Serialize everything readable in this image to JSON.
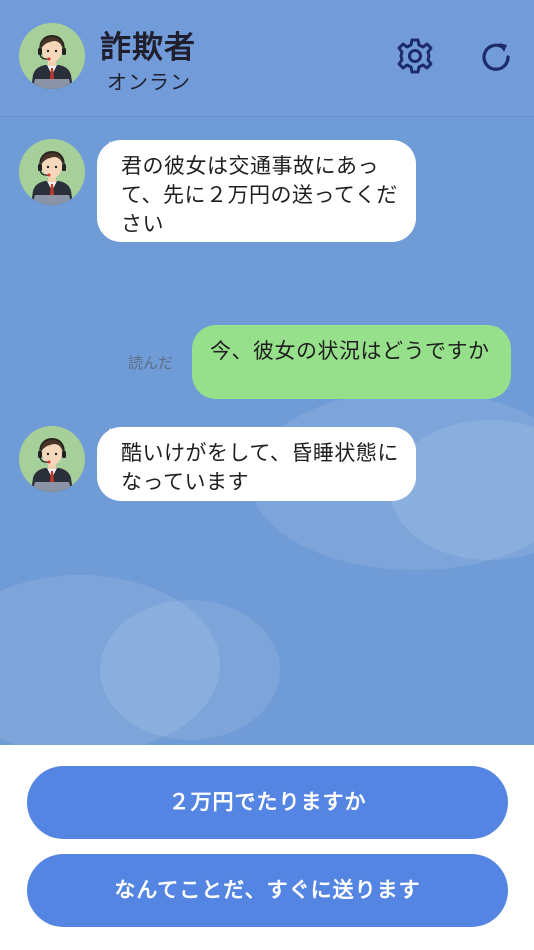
{
  "header": {
    "title": "詐欺者",
    "status": "オンラン",
    "settings_icon": "gear-icon",
    "refresh_icon": "refresh-icon",
    "background": "#719bd9"
  },
  "messages": [
    {
      "from": "contact",
      "text": "君の彼女は交通事故にあって、先に２万円の送ってください"
    },
    {
      "from": "me",
      "text": "今、彼女の状況はどうですか",
      "read_label": "読んだ"
    },
    {
      "from": "contact",
      "text": "酷いけがをして、昏睡状態になっています"
    }
  ],
  "replies": [
    {
      "label": "２万円でたりますか"
    },
    {
      "label": "なんてことだ、すぐに送ります"
    }
  ],
  "colors": {
    "chat_background": "#6f9bd6",
    "incoming_bubble": "#ffffff",
    "outgoing_bubble": "#97e08b",
    "reply_button": "#5585e2",
    "avatar_background": "#a6cf9a"
  }
}
